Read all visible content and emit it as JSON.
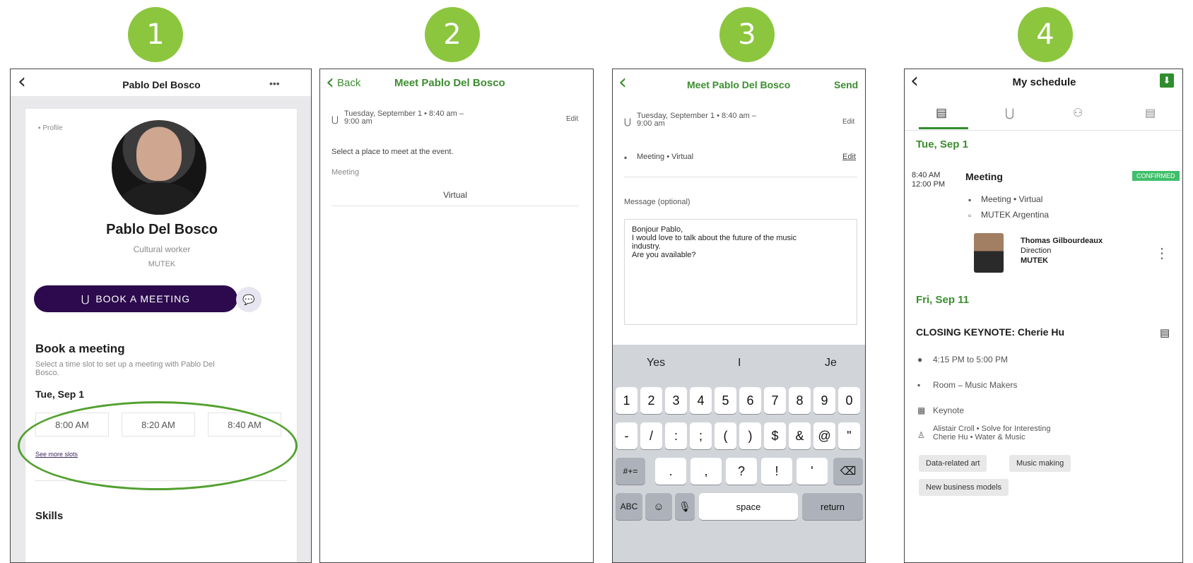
{
  "steps": [
    "1",
    "2",
    "3",
    "4"
  ],
  "screen1": {
    "title": "Pablo Del Bosco",
    "more": "•••",
    "profile_tag": "Profile",
    "name": "Pablo Del Bosco",
    "role": "Cultural worker",
    "company": "MUTEK",
    "book_button": "BOOK A MEETING",
    "section_title": "Book a meeting",
    "section_desc": "Select a time slot to set up a meeting with Pablo Del Bosco.",
    "date": "Tue, Sep 1",
    "slots": [
      "8:00 AM",
      "8:20 AM",
      "8:40 AM"
    ],
    "see_more": "See more slots",
    "skills_title": "Skills"
  },
  "screen2": {
    "back": "Back",
    "title": "Meet Pablo Del Bosco",
    "datetime_line1": "Tuesday, September 1 • 8:40 am –",
    "datetime_line2": "9:00 am",
    "edit": "Edit",
    "select_place": "Select a place to meet at the event.",
    "meeting_label": "Meeting",
    "virtual": "Virtual"
  },
  "screen3": {
    "title": "Meet Pablo Del Bosco",
    "send": "Send",
    "datetime_line1": "Tuesday, September 1 • 8:40 am –",
    "datetime_line2": "9:00 am",
    "edit1": "Edit",
    "meeting_line": "Meeting • Virtual",
    "edit2": "Edit",
    "message_label": "Message (optional)",
    "message_lines": [
      "Bonjour Pablo,",
      "I would love to talk about the future of the music",
      "industry.",
      "Are you available?"
    ],
    "suggestions": [
      "Yes",
      "I",
      "Je"
    ],
    "keys_row1": [
      "1",
      "2",
      "3",
      "4",
      "5",
      "6",
      "7",
      "8",
      "9",
      "0"
    ],
    "keys_row2": [
      "-",
      "/",
      ":",
      ";",
      "(",
      ")",
      "$",
      "&",
      "@",
      "\""
    ],
    "keys_row3": [
      ".",
      ",",
      "?",
      "!",
      "'"
    ],
    "key_sym": "#+=",
    "key_abc": "ABC",
    "key_space": "space",
    "key_return": "return"
  },
  "screen4": {
    "title": "My schedule",
    "date1": "Tue, Sep 1",
    "time_start": "8:40 AM",
    "time_end": "12:00 PM",
    "event1_title": "Meeting",
    "confirmed": "CONFIRMED",
    "event1_line1": "Meeting • Virtual",
    "event1_line2": "MUTEK Argentina",
    "person_name": "Thomas Gilbourdeaux",
    "person_role": "Direction",
    "person_company": "MUTEK",
    "date2": "Fri, Sep 11",
    "event2_title": "CLOSING KEYNOTE: Cherie Hu",
    "event2_time": "4:15 PM to 5:00 PM",
    "event2_room": "Room – Music Makers",
    "event2_type": "Keynote",
    "event2_speakers_l1": "Alistair Croll • Solve for Interesting",
    "event2_speakers_l2": "Cherie Hu • Water & Music",
    "tags": [
      "Data-related art",
      "Music making",
      "New business models"
    ]
  },
  "colors": {
    "accent_green": "#8cc63f",
    "header_green": "#3c8d2f",
    "primary_purple": "#2c0a4d"
  }
}
